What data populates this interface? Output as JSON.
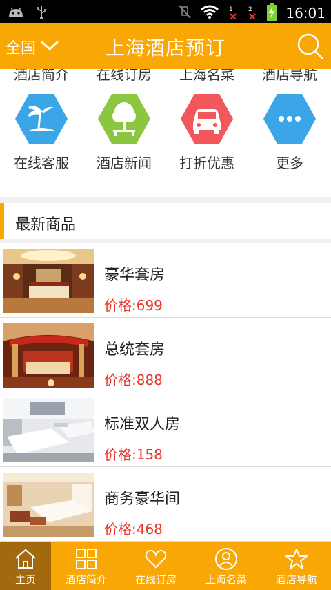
{
  "status_bar": {
    "time": "16:01",
    "icons": [
      "android-icon",
      "usb-icon",
      "mute-icon",
      "wifi-icon",
      "signal-1-icon",
      "signal-2-icon",
      "battery-charging-icon"
    ]
  },
  "header": {
    "region": "全国",
    "title": "上海酒店预订",
    "search_icon": "search-icon"
  },
  "top_nav_partial": [
    "酒店简介",
    "在线订房",
    "上海名菜",
    "酒店导航"
  ],
  "quick_links": [
    {
      "label": "在线客服",
      "icon": "palm-island-icon",
      "color": "#3aa6e8"
    },
    {
      "label": "酒店新闻",
      "icon": "tree-bench-icon",
      "color": "#8cc540"
    },
    {
      "label": "打折优惠",
      "icon": "car-icon",
      "color": "#f2575c"
    },
    {
      "label": "更多",
      "icon": "more-dots-icon",
      "color": "#3aa6e8"
    }
  ],
  "section": {
    "title": "最新商品"
  },
  "products": [
    {
      "name": "豪华套房",
      "price": "价格:699"
    },
    {
      "name": "总统套房",
      "price": "价格:888"
    },
    {
      "name": "标准双人房",
      "price": "价格:158"
    },
    {
      "name": "商务豪华间",
      "price": "价格:468"
    }
  ],
  "bottom_nav": [
    {
      "label": "主页",
      "icon": "home-icon",
      "active": true
    },
    {
      "label": "酒店简介",
      "icon": "grid-icon",
      "active": false
    },
    {
      "label": "在线订房",
      "icon": "heart-icon",
      "active": false
    },
    {
      "label": "上海名菜",
      "icon": "user-icon",
      "active": false
    },
    {
      "label": "酒店导航",
      "icon": "star-icon",
      "active": false
    }
  ],
  "colors": {
    "accent": "#f9a705",
    "active_tab": "#a2690f",
    "price": "#e8342b"
  }
}
